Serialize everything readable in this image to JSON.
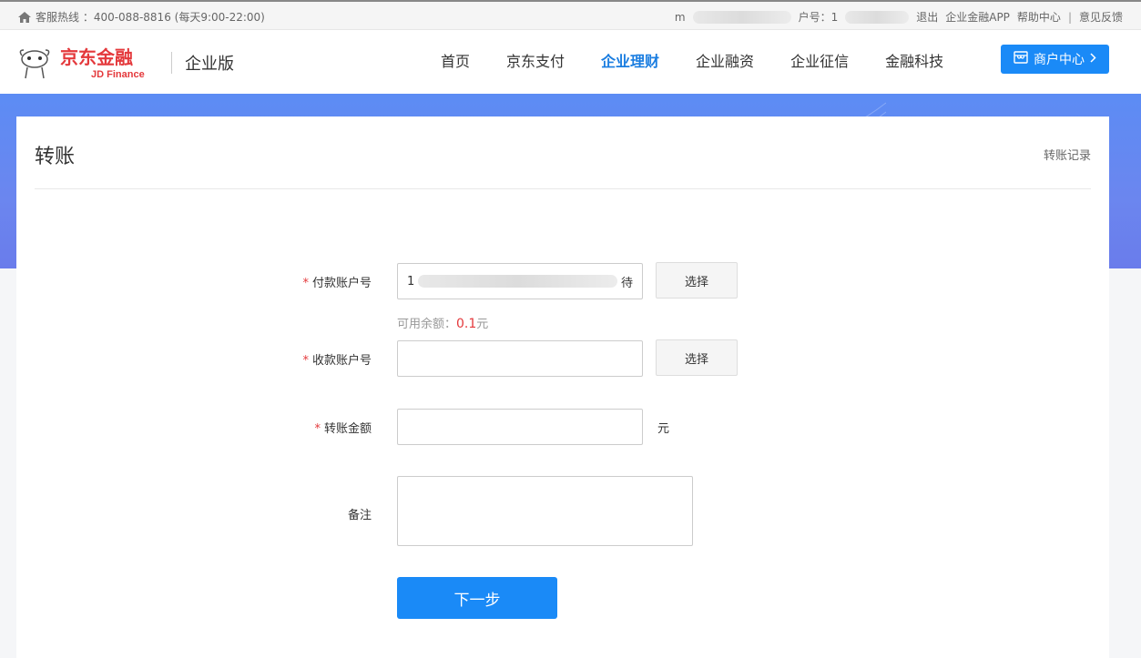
{
  "topbar": {
    "hotline_label": "客服热线 ：400-088-8816 (每天9:00-22:00)",
    "user_prefix": "m",
    "account_label": "户号：1",
    "logout": "退出",
    "app_link": "企业金融APP",
    "help_link": "帮助中心",
    "separator": "|",
    "feedback_link": "意见反馈"
  },
  "header": {
    "logo_cn": "京东金融",
    "logo_en": "JD Finance",
    "edition": "企业版",
    "nav": [
      {
        "label": "首页",
        "active": false
      },
      {
        "label": "京东支付",
        "active": false
      },
      {
        "label": "企业理财",
        "active": true
      },
      {
        "label": "企业融资",
        "active": false
      },
      {
        "label": "企业征信",
        "active": false
      },
      {
        "label": "金融科技",
        "active": false
      }
    ],
    "merchant_button": "商户中心",
    "colors": {
      "accent": "#1a8af7",
      "active_nav": "#1a7de0",
      "required": "#e4393c"
    }
  },
  "card": {
    "title": "转账",
    "records_link": "转账记录"
  },
  "form": {
    "required_mark": "*",
    "payer_label": "付款账户号",
    "payer_value_start": "1",
    "payer_value_end": "待",
    "payer_select": "选择",
    "balance_label": "可用余额：",
    "balance_amount": "0.1",
    "balance_unit": "元",
    "payee_label": "收款账户号",
    "payee_value": "",
    "payee_select": "选择",
    "amount_label": "转账金额",
    "amount_value": "",
    "amount_unit": "元",
    "remark_label": "备注",
    "remark_value": "",
    "next_button": "下一步"
  }
}
